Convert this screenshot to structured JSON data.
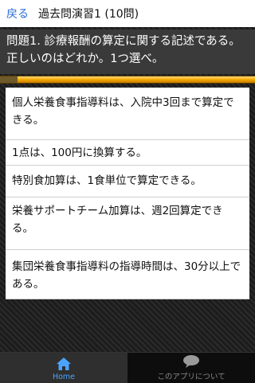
{
  "header": {
    "back_label": "戻る",
    "title": "過去問演習1 (10問)"
  },
  "question": {
    "text": "問題1. 診療報酬の算定に関する記述である。正しいのはどれか。1つ選べ。"
  },
  "progress": {
    "value_percent": 93
  },
  "choices": [
    {
      "text": "個人栄養食事指導料は、入院中3回まで算定できる。"
    },
    {
      "text": "1点は、100円に換算する。"
    },
    {
      "text": "特別食加算は、1食単位で算定できる。"
    },
    {
      "text": "栄養サポートチーム加算は、週2回算定できる。"
    },
    {
      "text": "集団栄養食事指導料の指導時間は、30分以上である。"
    }
  ],
  "tabs": [
    {
      "label": "Home",
      "icon": "home-icon",
      "active": true
    },
    {
      "label": "このアプリについて",
      "icon": "speech-bubble-icon",
      "active": false
    }
  ],
  "colors": {
    "back_link": "#2a6fd6",
    "active_tab": "#4aa3ff",
    "progress_fill": "#f6a800"
  }
}
